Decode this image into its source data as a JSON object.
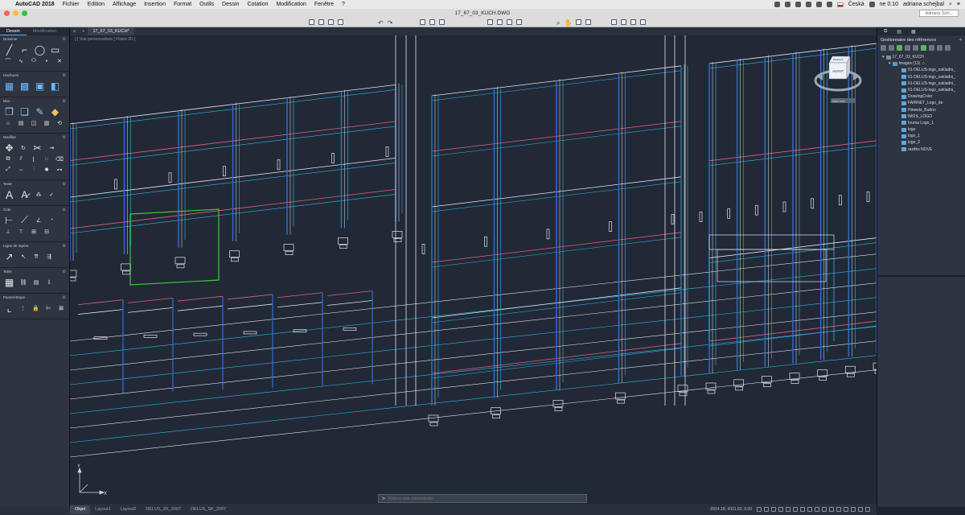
{
  "menubar": {
    "app_name": "AutoCAD 2018",
    "menus": [
      "Fichier",
      "Edition",
      "Affichage",
      "Insertion",
      "Format",
      "Outils",
      "Dessin",
      "Cotation",
      "Modification",
      "Fenêtre",
      "?"
    ],
    "keyboard_language": "Česká",
    "clock": "ne 0:10",
    "user": "adriana schejbal"
  },
  "window": {
    "document_title": "17_67_03_KUCH.DWG",
    "user_box": "Adriana Sch..."
  },
  "palette": {
    "tabs": [
      "Dessin",
      "Modification"
    ],
    "sections": [
      "Dessiner",
      "Hachures",
      "Bloc",
      "Modifier",
      "Texte",
      "Cote",
      "Ligne de repère",
      "Table",
      "Paramétrique"
    ]
  },
  "doc_tab": {
    "name": "17_67_03_KUCH*",
    "view_label": "[-] Vue personnalisée [ Filaire 2D ]"
  },
  "viewcube": {
    "face_label": "AVANT",
    "top_label": "DESSUS",
    "ucs_label": "Sans nom"
  },
  "reference_manager": {
    "title": "Gestionnaire des références",
    "root": "17_67_03_KUCH",
    "group_label": "Images (13)",
    "group_count": "13",
    "items": [
      "01-DELUS-logo_zakladni_",
      "01-DELUS-logo_zakladni_",
      "01-DELUS-logo_zakladni_",
      "01-DELUS-logo_zakladni_",
      "DrawingColor",
      "FAIRNET_Logo_de",
      "Hinweis_Button",
      "IMOS_LOGO",
      "Inuma Logo_1",
      "logo",
      "logo_1",
      "logo_2",
      "razitko NOVE"
    ]
  },
  "command_line": {
    "placeholder": "Entrez une commande"
  },
  "layout_bar": {
    "tabs": [
      "Objet",
      "Layout1",
      "Layout2",
      "DELUS_ZK_2007",
      "DELUS_SK_2007"
    ],
    "coordinates": "-3914.18, 4331.92, 0.00"
  },
  "colors": {
    "drawing_bg": "#222936",
    "cabinet_white": "#dfe5ee",
    "cabinet_cyan": "#2fb4e6",
    "cabinet_blue": "#2c6fd6",
    "cabinet_red": "#e0607a",
    "selection_green": "#3ec43e"
  }
}
